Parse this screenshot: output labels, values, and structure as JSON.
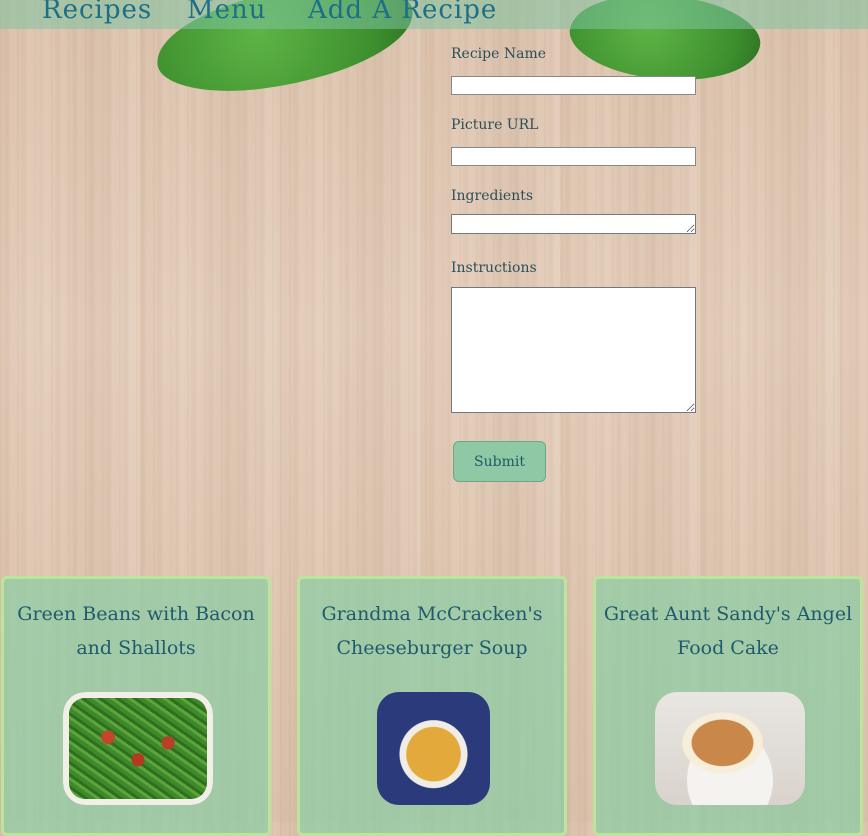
{
  "nav": {
    "items": [
      {
        "label": "Recipes"
      },
      {
        "label": "Menu"
      },
      {
        "label": "Add A Recipe"
      }
    ]
  },
  "form": {
    "recipe_name_label": "Recipe Name",
    "picture_url_label": "Picture URL",
    "ingredients_label": "Ingredients",
    "instructions_label": "Instructions",
    "submit_label": "Submit"
  },
  "recipes": [
    {
      "title": "Green Beans with Bacon and Shallots"
    },
    {
      "title": "Grandma McCracken's Cheeseburger Soup"
    },
    {
      "title": "Great Aunt Sandy's Angel Food Cake"
    }
  ]
}
